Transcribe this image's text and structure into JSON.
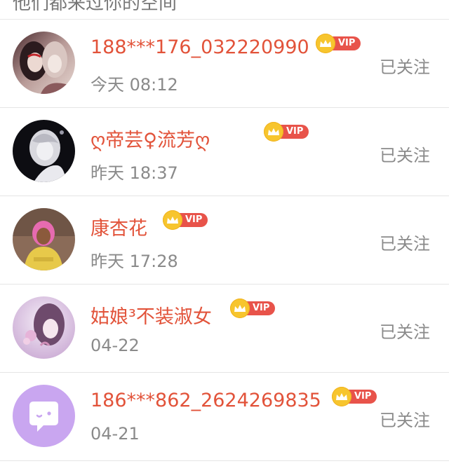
{
  "header": {
    "partial_text": "他们都来过你的空间"
  },
  "vip_label": "VIP",
  "follow_label": "已关注",
  "visitors": [
    {
      "name": "188***176_032220990",
      "time": "今天 08:12",
      "avatar": "anime-couple-avatar"
    },
    {
      "name": "ღ帝芸♀流芳ღ",
      "time": "昨天 18:37",
      "avatar": "anime-girl-dark-avatar"
    },
    {
      "name": "康杏花",
      "time": "昨天 17:28",
      "avatar": "photo-child-avatar"
    },
    {
      "name": "姑娘³不装淑女",
      "time": "04-22",
      "avatar": "anime-girl-flower-avatar"
    },
    {
      "name": "186***862_2624269835",
      "time": "04-21",
      "avatar": "default-chat-avatar"
    }
  ],
  "colors": {
    "name": "#e2533a",
    "vip_badge": "#e8534a",
    "crown": "#f7c52e",
    "muted_text": "#8a8a8a",
    "default_avatar": "#c9a6f0"
  }
}
